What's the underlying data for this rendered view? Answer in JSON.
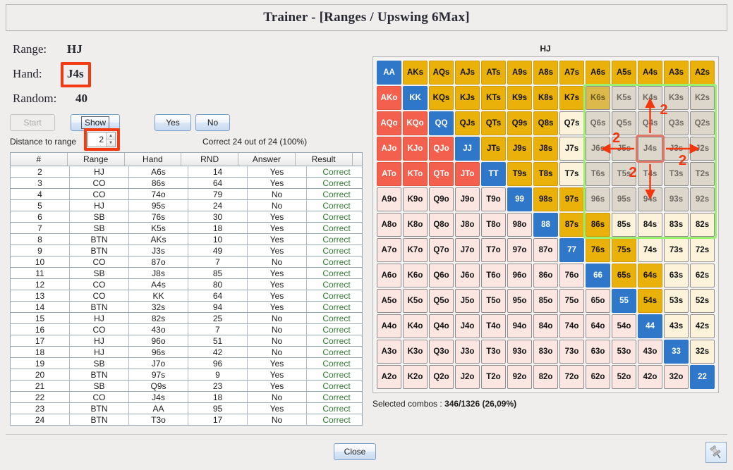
{
  "window": {
    "title": "Trainer - [Ranges / Upswing 6Max]",
    "close_label": "Close",
    "pin_icon": "pushpin-icon"
  },
  "info": {
    "range_label": "Range:",
    "range_value": "HJ",
    "hand_label": "Hand:",
    "hand_value": "J4s",
    "random_label": "Random:",
    "random_value": "40"
  },
  "controls": {
    "start_label": "Start",
    "show_label": "Show",
    "yes_label": "Yes",
    "no_label": "No",
    "distance_label": "Distance to range",
    "distance_value": "2",
    "correct_text": "Correct 24 out of 24 (100%)"
  },
  "table": {
    "headers": [
      "#",
      "Range",
      "Hand",
      "RND",
      "Answer",
      "Result"
    ],
    "rows": [
      [
        "2",
        "HJ",
        "A6s",
        "14",
        "Yes",
        "Correct"
      ],
      [
        "3",
        "CO",
        "86s",
        "64",
        "Yes",
        "Correct"
      ],
      [
        "4",
        "CO",
        "74o",
        "79",
        "No",
        "Correct"
      ],
      [
        "5",
        "HJ",
        "95s",
        "24",
        "No",
        "Correct"
      ],
      [
        "6",
        "SB",
        "76s",
        "30",
        "Yes",
        "Correct"
      ],
      [
        "7",
        "SB",
        "K5s",
        "18",
        "Yes",
        "Correct"
      ],
      [
        "8",
        "BTN",
        "AKs",
        "10",
        "Yes",
        "Correct"
      ],
      [
        "9",
        "BTN",
        "J3s",
        "49",
        "Yes",
        "Correct"
      ],
      [
        "10",
        "CO",
        "87o",
        "7",
        "No",
        "Correct"
      ],
      [
        "11",
        "SB",
        "J8s",
        "85",
        "Yes",
        "Correct"
      ],
      [
        "12",
        "CO",
        "A4s",
        "80",
        "Yes",
        "Correct"
      ],
      [
        "13",
        "CO",
        "KK",
        "64",
        "Yes",
        "Correct"
      ],
      [
        "14",
        "BTN",
        "32s",
        "94",
        "Yes",
        "Correct"
      ],
      [
        "15",
        "HJ",
        "82s",
        "25",
        "No",
        "Correct"
      ],
      [
        "16",
        "CO",
        "43o",
        "7",
        "No",
        "Correct"
      ],
      [
        "17",
        "HJ",
        "96o",
        "51",
        "No",
        "Correct"
      ],
      [
        "18",
        "HJ",
        "96s",
        "42",
        "No",
        "Correct"
      ],
      [
        "19",
        "SB",
        "J7o",
        "96",
        "Yes",
        "Correct"
      ],
      [
        "20",
        "BTN",
        "97s",
        "9",
        "Yes",
        "Correct"
      ],
      [
        "21",
        "SB",
        "Q9s",
        "23",
        "Yes",
        "Correct"
      ],
      [
        "22",
        "CO",
        "J4s",
        "18",
        "No",
        "Correct"
      ],
      [
        "23",
        "BTN",
        "AA",
        "95",
        "Yes",
        "Correct"
      ],
      [
        "24",
        "BTN",
        "T3o",
        "17",
        "No",
        "Correct"
      ]
    ]
  },
  "matrix": {
    "title": "HJ",
    "selected_combos_label": "Selected combos : ",
    "selected_combos_value": "346/1326 (26,09%)",
    "ranks": [
      "A",
      "K",
      "Q",
      "J",
      "T",
      "9",
      "8",
      "7",
      "6",
      "5",
      "4",
      "3",
      "2"
    ],
    "cells": [
      [
        {
          "t": "AA",
          "c": "pair"
        },
        {
          "t": "AKs",
          "c": "gold"
        },
        {
          "t": "AQs",
          "c": "gold"
        },
        {
          "t": "AJs",
          "c": "gold"
        },
        {
          "t": "ATs",
          "c": "gold"
        },
        {
          "t": "A9s",
          "c": "gold"
        },
        {
          "t": "A8s",
          "c": "gold"
        },
        {
          "t": "A7s",
          "c": "gold"
        },
        {
          "t": "A6s",
          "c": "gold"
        },
        {
          "t": "A5s",
          "c": "gold"
        },
        {
          "t": "A4s",
          "c": "gold"
        },
        {
          "t": "A3s",
          "c": "gold"
        },
        {
          "t": "A2s",
          "c": "gold"
        }
      ],
      [
        {
          "t": "AKo",
          "c": "off"
        },
        {
          "t": "KK",
          "c": "pair"
        },
        {
          "t": "KQs",
          "c": "gold"
        },
        {
          "t": "KJs",
          "c": "gold"
        },
        {
          "t": "KTs",
          "c": "gold"
        },
        {
          "t": "K9s",
          "c": "gold"
        },
        {
          "t": "K8s",
          "c": "gold"
        },
        {
          "t": "K7s",
          "c": "gold"
        },
        {
          "t": "K6s",
          "c": "dimgold"
        },
        {
          "t": "K5s",
          "c": "dim"
        },
        {
          "t": "K4s",
          "c": "dim"
        },
        {
          "t": "K3s",
          "c": "dim"
        },
        {
          "t": "K2s",
          "c": "dim"
        }
      ],
      [
        {
          "t": "AQo",
          "c": "off"
        },
        {
          "t": "KQo",
          "c": "off"
        },
        {
          "t": "QQ",
          "c": "pair"
        },
        {
          "t": "QJs",
          "c": "gold"
        },
        {
          "t": "QTs",
          "c": "gold"
        },
        {
          "t": "Q9s",
          "c": "gold"
        },
        {
          "t": "Q8s",
          "c": "gold"
        },
        {
          "t": "Q7s",
          "c": "cream"
        },
        {
          "t": "Q6s",
          "c": "dim"
        },
        {
          "t": "Q5s",
          "c": "dim"
        },
        {
          "t": "Q4s",
          "c": "dim"
        },
        {
          "t": "Q3s",
          "c": "dim"
        },
        {
          "t": "Q2s",
          "c": "dim"
        }
      ],
      [
        {
          "t": "AJo",
          "c": "off"
        },
        {
          "t": "KJo",
          "c": "off"
        },
        {
          "t": "QJo",
          "c": "off"
        },
        {
          "t": "JJ",
          "c": "pair"
        },
        {
          "t": "JTs",
          "c": "gold"
        },
        {
          "t": "J9s",
          "c": "gold"
        },
        {
          "t": "J8s",
          "c": "gold"
        },
        {
          "t": "J7s",
          "c": "cream"
        },
        {
          "t": "J6s",
          "c": "dim"
        },
        {
          "t": "J5s",
          "c": "dim"
        },
        {
          "t": "J4s",
          "c": "dim"
        },
        {
          "t": "J3s",
          "c": "dim"
        },
        {
          "t": "J2s",
          "c": "dim"
        }
      ],
      [
        {
          "t": "ATo",
          "c": "off"
        },
        {
          "t": "KTo",
          "c": "off"
        },
        {
          "t": "QTo",
          "c": "off"
        },
        {
          "t": "JTo",
          "c": "off"
        },
        {
          "t": "TT",
          "c": "pair"
        },
        {
          "t": "T9s",
          "c": "gold"
        },
        {
          "t": "T8s",
          "c": "gold"
        },
        {
          "t": "T7s",
          "c": "cream"
        },
        {
          "t": "T6s",
          "c": "dim"
        },
        {
          "t": "T5s",
          "c": "dim"
        },
        {
          "t": "T4s",
          "c": "dim"
        },
        {
          "t": "T3s",
          "c": "dim"
        },
        {
          "t": "T2s",
          "c": "dim"
        }
      ],
      [
        {
          "t": "A9o",
          "c": "pink"
        },
        {
          "t": "K9o",
          "c": "pink"
        },
        {
          "t": "Q9o",
          "c": "pink"
        },
        {
          "t": "J9o",
          "c": "pink"
        },
        {
          "t": "T9o",
          "c": "pink"
        },
        {
          "t": "99",
          "c": "pair"
        },
        {
          "t": "98s",
          "c": "gold"
        },
        {
          "t": "97s",
          "c": "gold"
        },
        {
          "t": "96s",
          "c": "dim"
        },
        {
          "t": "95s",
          "c": "dim"
        },
        {
          "t": "94s",
          "c": "dim"
        },
        {
          "t": "93s",
          "c": "dim"
        },
        {
          "t": "92s",
          "c": "dim"
        }
      ],
      [
        {
          "t": "A8o",
          "c": "pink"
        },
        {
          "t": "K8o",
          "c": "pink"
        },
        {
          "t": "Q8o",
          "c": "pink"
        },
        {
          "t": "J8o",
          "c": "pink"
        },
        {
          "t": "T8o",
          "c": "pink"
        },
        {
          "t": "98o",
          "c": "pink"
        },
        {
          "t": "88",
          "c": "pair"
        },
        {
          "t": "87s",
          "c": "gold"
        },
        {
          "t": "86s",
          "c": "gold"
        },
        {
          "t": "85s",
          "c": "cream"
        },
        {
          "t": "84s",
          "c": "cream"
        },
        {
          "t": "83s",
          "c": "cream"
        },
        {
          "t": "82s",
          "c": "cream"
        }
      ],
      [
        {
          "t": "A7o",
          "c": "pink"
        },
        {
          "t": "K7o",
          "c": "pink"
        },
        {
          "t": "Q7o",
          "c": "pink"
        },
        {
          "t": "J7o",
          "c": "pink"
        },
        {
          "t": "T7o",
          "c": "pink"
        },
        {
          "t": "97o",
          "c": "pink"
        },
        {
          "t": "87o",
          "c": "pink"
        },
        {
          "t": "77",
          "c": "pair"
        },
        {
          "t": "76s",
          "c": "gold"
        },
        {
          "t": "75s",
          "c": "gold"
        },
        {
          "t": "74s",
          "c": "cream"
        },
        {
          "t": "73s",
          "c": "cream"
        },
        {
          "t": "72s",
          "c": "cream"
        }
      ],
      [
        {
          "t": "A6o",
          "c": "pink"
        },
        {
          "t": "K6o",
          "c": "pink"
        },
        {
          "t": "Q6o",
          "c": "pink"
        },
        {
          "t": "J6o",
          "c": "pink"
        },
        {
          "t": "T6o",
          "c": "pink"
        },
        {
          "t": "96o",
          "c": "pink"
        },
        {
          "t": "86o",
          "c": "pink"
        },
        {
          "t": "76o",
          "c": "pink"
        },
        {
          "t": "66",
          "c": "pair"
        },
        {
          "t": "65s",
          "c": "gold"
        },
        {
          "t": "64s",
          "c": "gold"
        },
        {
          "t": "63s",
          "c": "cream"
        },
        {
          "t": "62s",
          "c": "cream"
        }
      ],
      [
        {
          "t": "A5o",
          "c": "pink"
        },
        {
          "t": "K5o",
          "c": "pink"
        },
        {
          "t": "Q5o",
          "c": "pink"
        },
        {
          "t": "J5o",
          "c": "pink"
        },
        {
          "t": "T5o",
          "c": "pink"
        },
        {
          "t": "95o",
          "c": "pink"
        },
        {
          "t": "85o",
          "c": "pink"
        },
        {
          "t": "75o",
          "c": "pink"
        },
        {
          "t": "65o",
          "c": "pink"
        },
        {
          "t": "55",
          "c": "pair"
        },
        {
          "t": "54s",
          "c": "gold"
        },
        {
          "t": "53s",
          "c": "cream"
        },
        {
          "t": "52s",
          "c": "cream"
        }
      ],
      [
        {
          "t": "A4o",
          "c": "pink"
        },
        {
          "t": "K4o",
          "c": "pink"
        },
        {
          "t": "Q4o",
          "c": "pink"
        },
        {
          "t": "J4o",
          "c": "pink"
        },
        {
          "t": "T4o",
          "c": "pink"
        },
        {
          "t": "94o",
          "c": "pink"
        },
        {
          "t": "84o",
          "c": "pink"
        },
        {
          "t": "74o",
          "c": "pink"
        },
        {
          "t": "64o",
          "c": "pink"
        },
        {
          "t": "54o",
          "c": "pink"
        },
        {
          "t": "44",
          "c": "pair"
        },
        {
          "t": "43s",
          "c": "cream"
        },
        {
          "t": "42s",
          "c": "cream"
        }
      ],
      [
        {
          "t": "A3o",
          "c": "pink"
        },
        {
          "t": "K3o",
          "c": "pink"
        },
        {
          "t": "Q3o",
          "c": "pink"
        },
        {
          "t": "J3o",
          "c": "pink"
        },
        {
          "t": "T3o",
          "c": "pink"
        },
        {
          "t": "93o",
          "c": "pink"
        },
        {
          "t": "83o",
          "c": "pink"
        },
        {
          "t": "73o",
          "c": "pink"
        },
        {
          "t": "63o",
          "c": "pink"
        },
        {
          "t": "53o",
          "c": "pink"
        },
        {
          "t": "43o",
          "c": "pink"
        },
        {
          "t": "33",
          "c": "pair"
        },
        {
          "t": "32s",
          "c": "cream"
        }
      ],
      [
        {
          "t": "A2o",
          "c": "pink"
        },
        {
          "t": "K2o",
          "c": "pink"
        },
        {
          "t": "Q2o",
          "c": "pink"
        },
        {
          "t": "J2o",
          "c": "pink"
        },
        {
          "t": "T2o",
          "c": "pink"
        },
        {
          "t": "92o",
          "c": "pink"
        },
        {
          "t": "82o",
          "c": "pink"
        },
        {
          "t": "72o",
          "c": "pink"
        },
        {
          "t": "62o",
          "c": "pink"
        },
        {
          "t": "52o",
          "c": "pink"
        },
        {
          "t": "42o",
          "c": "pink"
        },
        {
          "t": "32o",
          "c": "pink"
        },
        {
          "t": "22",
          "c": "pair"
        }
      ]
    ],
    "annotations": {
      "target_cell": "J4s",
      "distance_labels": [
        "2",
        "2",
        "2",
        "2"
      ],
      "arrows": [
        {
          "dir": "up",
          "from": "J4s",
          "to": "K4s",
          "label": "2"
        },
        {
          "dir": "left",
          "from": "J4s",
          "to": "J6s",
          "label": "2"
        },
        {
          "dir": "right",
          "from": "J4s",
          "to": "J2s",
          "label": "2"
        },
        {
          "dir": "down",
          "from": "J4s",
          "to": "94s",
          "label": "2"
        }
      ]
    },
    "colors": {
      "pair": "#2f77c9",
      "offsuit": "#f4604e",
      "suited": "#e9b10a",
      "cream": "#fdf2da",
      "pink": "#fbe6e2",
      "dimmed": "#ddd6cb",
      "selection_outline": "#9cf070",
      "annotation": "#f2360e"
    }
  }
}
